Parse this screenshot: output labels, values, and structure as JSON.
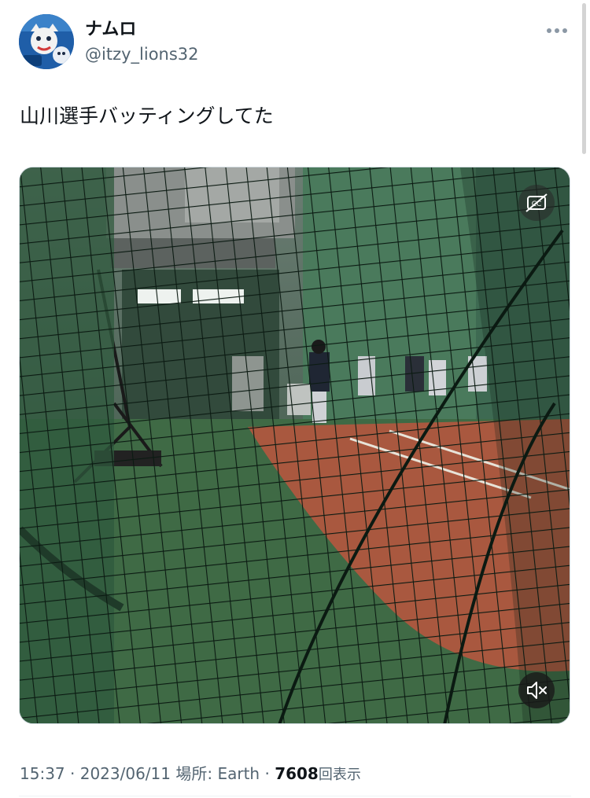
{
  "author": {
    "display_name": "ナムロ",
    "handle": "@itzy_lions32",
    "avatar_icon": "mascot-avatar-icon"
  },
  "tweet": {
    "text": "山川選手バッティングしてた"
  },
  "media": {
    "type": "video",
    "captions_icon": "closed-captions-icon",
    "mute_icon": "muted-speaker-icon"
  },
  "meta": {
    "time": "15:37",
    "date": "2023/06/11",
    "location_label": "場所:",
    "location": "Earth",
    "views_count": "7608",
    "views_label": "回表示",
    "separator": "·"
  },
  "colors": {
    "text_primary": "#0f1419",
    "text_secondary": "#536471",
    "turf": "#3f6a45",
    "clay": "#a9583f"
  }
}
